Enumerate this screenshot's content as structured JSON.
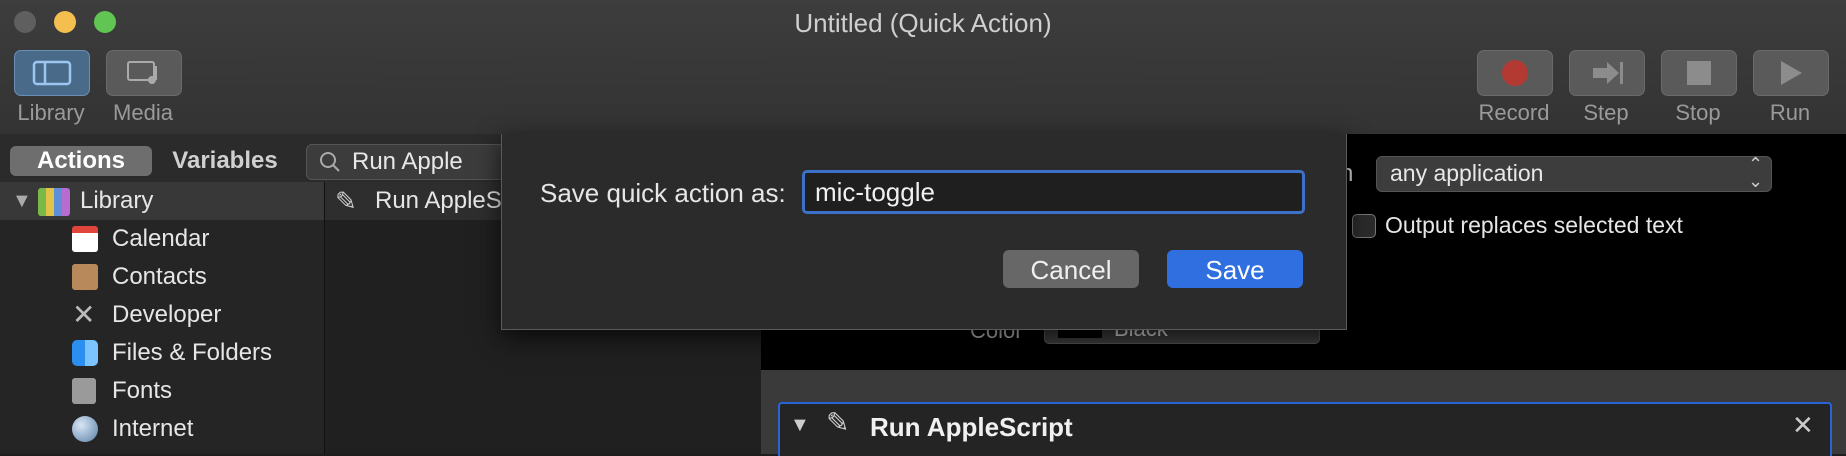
{
  "window": {
    "title": "Untitled (Quick Action)"
  },
  "toolbar": {
    "library_label": "Library",
    "media_label": "Media",
    "record_label": "Record",
    "step_label": "Step",
    "stop_label": "Stop",
    "run_label": "Run",
    "record_color": "#c0392b"
  },
  "tabs": {
    "actions": "Actions",
    "variables": "Variables"
  },
  "search": {
    "value": "Run Apple"
  },
  "library": {
    "root": "Library",
    "items": [
      "Calendar",
      "Contacts",
      "Developer",
      "Files & Folders",
      "Fonts",
      "Internet"
    ]
  },
  "actions_list": {
    "item0": "Run AppleSc"
  },
  "workflow": {
    "in_label_fragment": "n",
    "application_value": "any application",
    "output_replaces_label": "Output replaces selected text",
    "color_label": "Color",
    "color_value": "Black",
    "action_title": "Run AppleScript"
  },
  "save_sheet": {
    "prompt": "Save quick action as:",
    "value": "mic-toggle",
    "cancel": "Cancel",
    "save": "Save"
  }
}
